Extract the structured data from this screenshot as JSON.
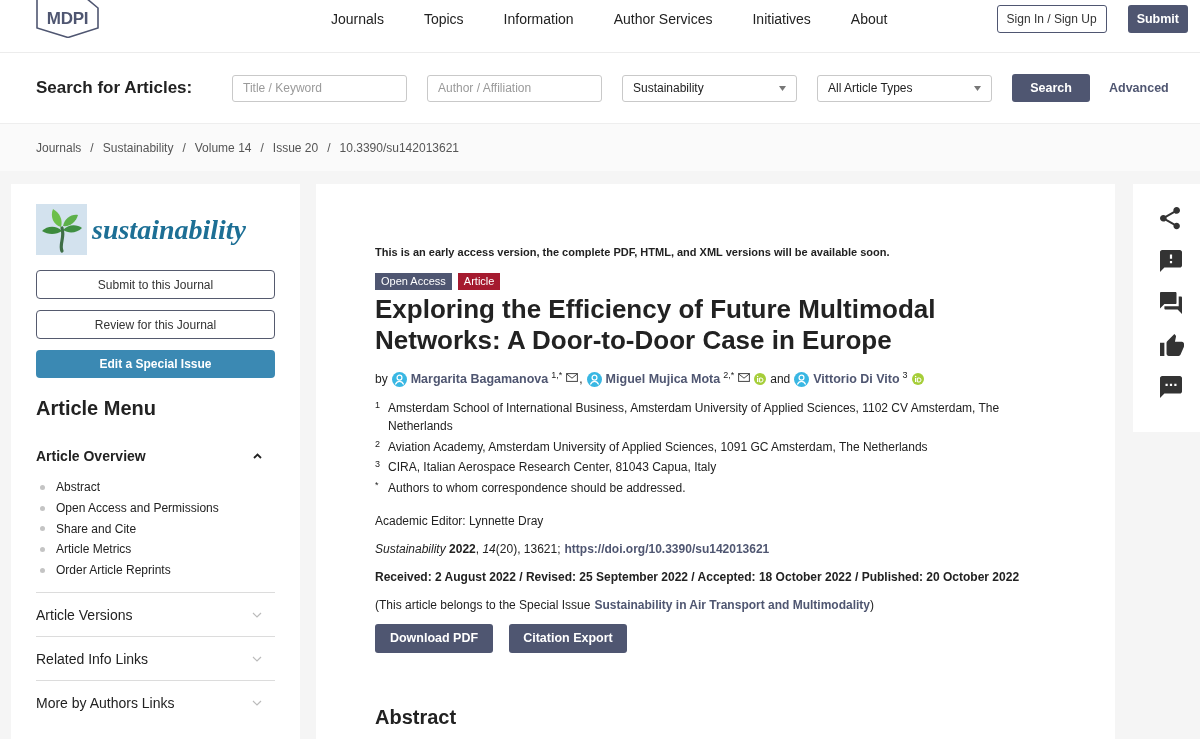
{
  "header": {
    "logo": "MDPI",
    "nav": [
      "Journals",
      "Topics",
      "Information",
      "Author Services",
      "Initiatives",
      "About"
    ],
    "sign_in": "Sign In / Sign Up",
    "submit": "Submit"
  },
  "search": {
    "label": "Search for Articles:",
    "fields": [
      {
        "kind": "text",
        "placeholder": "Title / Keyword"
      },
      {
        "kind": "text",
        "placeholder": "Author / Affiliation"
      },
      {
        "kind": "select",
        "value": "Sustainability"
      },
      {
        "kind": "select",
        "value": "All Article Types"
      }
    ],
    "button": "Search",
    "advanced": "Advanced"
  },
  "breadcrumb": {
    "separator": "/",
    "items": [
      "Journals",
      "Sustainability",
      "Volume 14",
      "Issue 20",
      "10.3390/su142013621"
    ]
  },
  "sidebar": {
    "journal": "sustainability",
    "buttons": [
      {
        "kind": "outline",
        "label": "Submit to this Journal"
      },
      {
        "kind": "outline",
        "label": "Review for this Journal"
      },
      {
        "kind": "filled",
        "label": "Edit a Special Issue"
      }
    ],
    "menu_title": "Article Menu",
    "sections": [
      {
        "title": "Article Overview",
        "expanded": true,
        "items": [
          "Abstract",
          "Open Access and Permissions",
          "Share and Cite",
          "Article Metrics",
          "Order Article Reprints"
        ]
      },
      {
        "title": "Article Versions",
        "expanded": false
      },
      {
        "title": "Related Info Links",
        "expanded": false
      },
      {
        "title": "More by Authors Links",
        "expanded": false
      }
    ]
  },
  "article": {
    "notice": "This is an early access version, the complete PDF, HTML, and XML versions will be available soon.",
    "tags": [
      {
        "label": "Open Access",
        "color": "#4f5671"
      },
      {
        "label": "Article",
        "color": "#a51a2f"
      }
    ],
    "title": "Exploring the Efficiency of Future Multimodal Networks: A Door-to-Door Case in Europe",
    "byline": "by",
    "authors": [
      {
        "name": "Margarita Bagamanova",
        "sup": "1,*",
        "email": true,
        "orcid": false
      },
      {
        "lead": ",",
        "name": "Miguel Mujica Mota",
        "sup": "2,*",
        "email": true,
        "orcid": true
      },
      {
        "lead": "and",
        "name": "Vittorio Di Vito",
        "sup": "3",
        "email": false,
        "orcid": true
      }
    ],
    "affiliations": [
      {
        "mark": "1",
        "text": "Amsterdam School of International Business, Amsterdam University of Applied Sciences, 1102 CV Amsterdam, The Netherlands"
      },
      {
        "mark": "2",
        "text": "Aviation Academy, Amsterdam University of Applied Sciences, 1091 GC Amsterdam, The Netherlands"
      },
      {
        "mark": "3",
        "text": "CIRA, Italian Aerospace Research Center, 81043 Capua, Italy"
      },
      {
        "mark": "*",
        "text": "Authors to whom correspondence should be addressed."
      }
    ],
    "editor": "Academic Editor: Lynnette Dray",
    "citation": {
      "text": "*Sustainability* **2022**, *14*(20), 13621;",
      "doi": "https://doi.org/10.3390/su142013621"
    },
    "dates": "Received: 2 August 2022 / Revised: 25 September 2022 / Accepted: 18 October 2022 / Published: 20 October 2022",
    "special_issue": {
      "text": "(This article belongs to the Special Issue",
      "link": "Sustainability in Air Transport and Multimodality",
      "close": ")"
    },
    "buttons": [
      "Download PDF",
      "Citation Export"
    ],
    "abstract_heading": "Abstract"
  }
}
